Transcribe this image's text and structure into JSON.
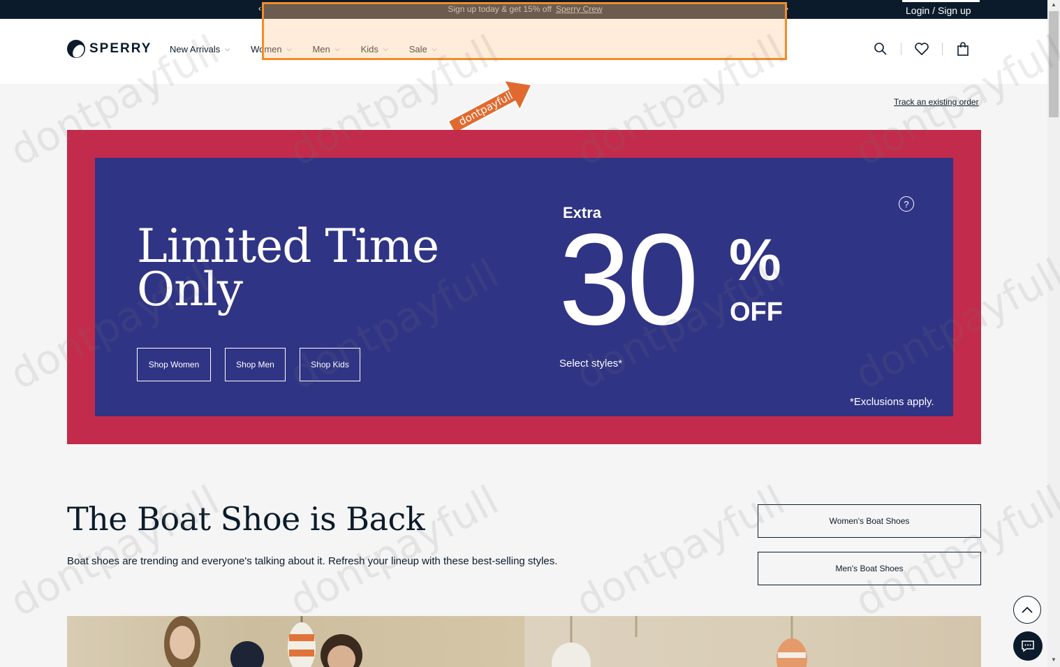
{
  "promo": {
    "message": "Sign up today & get 15% off",
    "link": "Sperry Crew",
    "prev_arrow": "‹",
    "next_arrow": "›"
  },
  "account": {
    "login": "Login /",
    "signup": "Sign up"
  },
  "logo": {
    "text": "SPERRY"
  },
  "nav": {
    "items": [
      {
        "label": "New Arrivals"
      },
      {
        "label": "Women"
      },
      {
        "label": "Men"
      },
      {
        "label": "Kids"
      },
      {
        "label": "Sale"
      }
    ]
  },
  "icons": {
    "search": "search-icon",
    "wishlist": "heart-icon",
    "cart": "bag-icon"
  },
  "track_order": "Track an existing order",
  "stamp": {
    "text": "dontpayfull"
  },
  "hero": {
    "title_line1": "Limited Time",
    "title_line2": "Only",
    "buttons": [
      "Shop Women",
      "Shop Men",
      "Shop Kids"
    ],
    "offer_extra": "Extra",
    "offer_number": "30",
    "offer_percent": "%",
    "offer_off": "OFF",
    "offer_select": "Select styles*",
    "exclusions": "*Exclusions apply.",
    "help": "?"
  },
  "boat": {
    "title": "The Boat Shoe is Back",
    "description": "Boat shoes are trending and everyone's talking about it. Refresh your lineup with these best-selling styles.",
    "womens_button": "Women's Boat Shoes",
    "mens_button": "Men's Boat Shoes"
  },
  "watermark": "dontpayfull",
  "colors": {
    "navy": "#0b1b2b",
    "hero_red": "#c22b4b",
    "hero_blue": "#303484",
    "highlight": "#f28c28"
  }
}
